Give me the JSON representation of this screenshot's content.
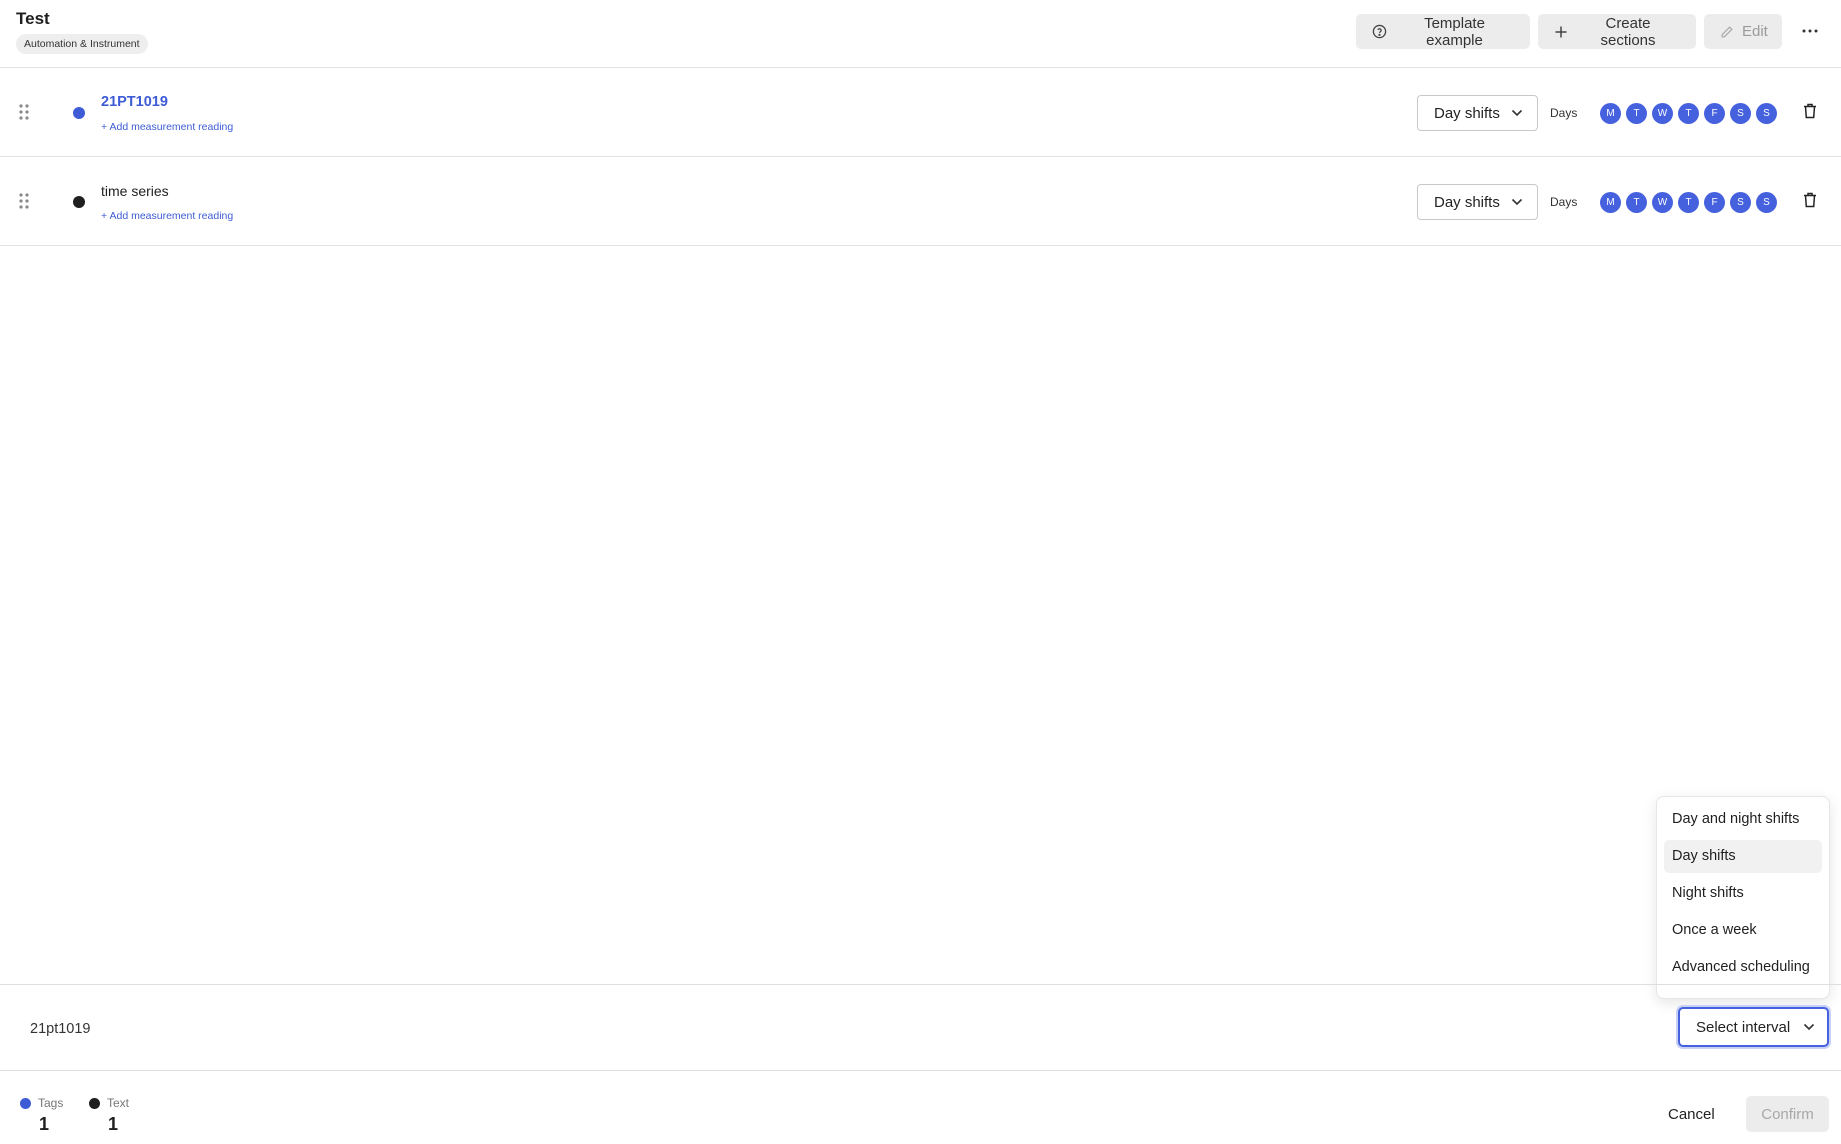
{
  "header": {
    "title": "Test",
    "category": "Automation & Instrument",
    "template_example_label": "Template example",
    "create_sections_label": "Create sections",
    "edit_label": "Edit",
    "more_icon": "more-horizontal-icon"
  },
  "rows": [
    {
      "name": "21PT1019",
      "kind": "tag",
      "dot_color": "#3e5cd6",
      "add_reading_label": "+ Add measurement reading",
      "interval": "Day shifts",
      "days_label": "Days",
      "days": [
        "M",
        "T",
        "W",
        "T",
        "F",
        "S",
        "S"
      ]
    },
    {
      "name": "time series",
      "kind": "text",
      "dot_color": "#1f1f1f",
      "add_reading_label": "+ Add measurement reading",
      "interval": "Day shifts",
      "days_label": "Days",
      "days": [
        "M",
        "T",
        "W",
        "T",
        "F",
        "S",
        "S"
      ]
    }
  ],
  "bottom_bar": {
    "selected_name": "21pt1019",
    "select_interval_label": "Select interval"
  },
  "interval_menu": {
    "options": [
      "Day and night shifts",
      "Day shifts",
      "Night shifts",
      "Once a week",
      "Advanced scheduling"
    ],
    "highlighted": "Day shifts"
  },
  "footer": {
    "legend": [
      {
        "label": "Tags",
        "count": "1",
        "color": "#3e5cd6"
      },
      {
        "label": "Text",
        "count": "1",
        "color": "#1f1f1f"
      }
    ],
    "cancel_label": "Cancel",
    "confirm_label": "Confirm"
  },
  "colors": {
    "accent": "#4661dd",
    "tag_text": "#3e5cd6"
  }
}
